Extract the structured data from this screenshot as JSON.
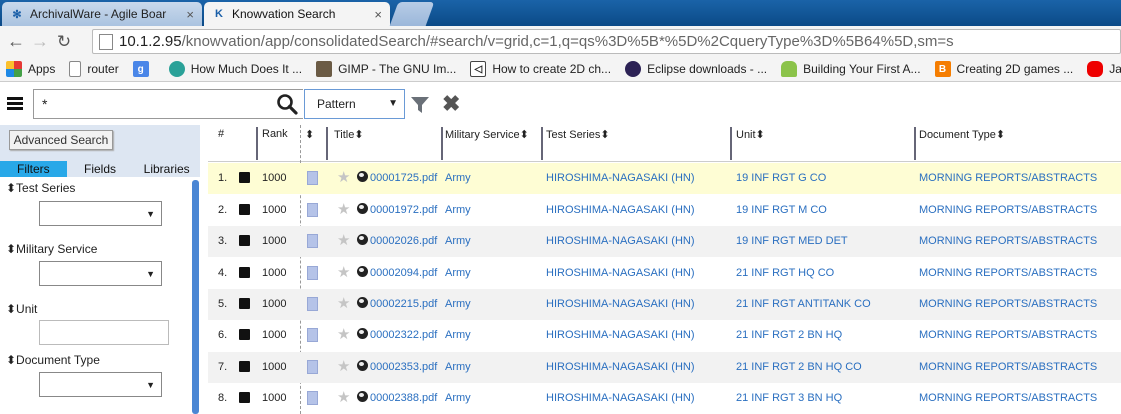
{
  "browser": {
    "tabs": [
      {
        "title": "ArchivalWare - Agile Boar",
        "close": "×"
      },
      {
        "title": "Knowvation Search",
        "close": "×"
      }
    ],
    "url_host": "10.1.2.95",
    "url_path": "/knowvation/app/consolidatedSearch/#search/v=grid,c=1,q=qs%3D%5B*%5D%2CqueryType%3D%5B64%5D,sm=s",
    "bookmarks": [
      {
        "label": "Apps"
      },
      {
        "label": "router"
      },
      {
        "label": ""
      },
      {
        "label": "How Much Does It ..."
      },
      {
        "label": "GIMP - The GNU Im..."
      },
      {
        "label": "How to create 2D ch..."
      },
      {
        "label": "Eclipse downloads - ..."
      },
      {
        "label": "Building Your First A..."
      },
      {
        "label": "Creating 2D games ..."
      },
      {
        "label": "Java SE D"
      }
    ]
  },
  "toolbar": {
    "search_value": "*",
    "mode_select": "Pattern"
  },
  "left_panel": {
    "advanced_search": "Advanced Search",
    "tabs": [
      "Filters",
      "Fields",
      "Libraries"
    ],
    "filters": [
      {
        "label": "⬍Test Series"
      },
      {
        "label": "⬍Military Service"
      },
      {
        "label": "⬍Unit"
      },
      {
        "label": "⬍Document Type"
      }
    ]
  },
  "grid": {
    "columns": {
      "num": "#",
      "rank": "Rank",
      "title": "Title⬍",
      "military_service": "Military Service⬍",
      "test_series": "Test Series⬍",
      "unit": "Unit⬍",
      "document_type": "Document Type⬍"
    },
    "rows": [
      {
        "num": "1.",
        "rank": "1000",
        "title": "00001725.pdf",
        "service": "Army",
        "series": "HIROSHIMA-NAGASAKI (HN)",
        "unit": "19 INF RGT G CO",
        "doctype": "MORNING REPORTS/ABSTRACTS"
      },
      {
        "num": "2.",
        "rank": "1000",
        "title": "00001972.pdf",
        "service": "Army",
        "series": "HIROSHIMA-NAGASAKI (HN)",
        "unit": "19 INF RGT M CO",
        "doctype": "MORNING REPORTS/ABSTRACTS"
      },
      {
        "num": "3.",
        "rank": "1000",
        "title": "00002026.pdf",
        "service": "Army",
        "series": "HIROSHIMA-NAGASAKI (HN)",
        "unit": "19 INF RGT MED DET",
        "doctype": "MORNING REPORTS/ABSTRACTS"
      },
      {
        "num": "4.",
        "rank": "1000",
        "title": "00002094.pdf",
        "service": "Army",
        "series": "HIROSHIMA-NAGASAKI (HN)",
        "unit": "21 INF RGT HQ CO",
        "doctype": "MORNING REPORTS/ABSTRACTS"
      },
      {
        "num": "5.",
        "rank": "1000",
        "title": "00002215.pdf",
        "service": "Army",
        "series": "HIROSHIMA-NAGASAKI (HN)",
        "unit": "21 INF RGT ANTITANK CO",
        "doctype": "MORNING REPORTS/ABSTRACTS"
      },
      {
        "num": "6.",
        "rank": "1000",
        "title": "00002322.pdf",
        "service": "Army",
        "series": "HIROSHIMA-NAGASAKI (HN)",
        "unit": "21 INF RGT 2 BN HQ",
        "doctype": "MORNING REPORTS/ABSTRACTS"
      },
      {
        "num": "7.",
        "rank": "1000",
        "title": "00002353.pdf",
        "service": "Army",
        "series": "HIROSHIMA-NAGASAKI (HN)",
        "unit": "21 INF RGT 2 BN HQ CO",
        "doctype": "MORNING REPORTS/ABSTRACTS"
      },
      {
        "num": "8.",
        "rank": "1000",
        "title": "00002388.pdf",
        "service": "Army",
        "series": "HIROSHIMA-NAGASAKI (HN)",
        "unit": "21 INF RGT 3 BN HQ",
        "doctype": "MORNING REPORTS/ABSTRACTS"
      }
    ]
  }
}
